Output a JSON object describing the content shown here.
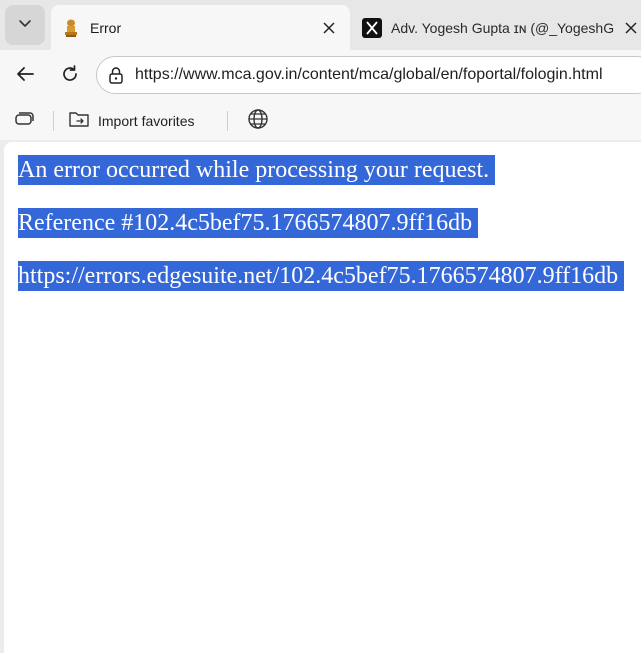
{
  "tabs": [
    {
      "title": "Error",
      "favicon": "emblem-icon",
      "active": true
    },
    {
      "title": "Adv. Yogesh Gupta ɪɴ (@_YogeshG",
      "favicon": "x-logo-icon",
      "active": false
    }
  ],
  "address_bar": {
    "url": "https://www.mca.gov.in/content/mca/global/en/foportal/fologin.html"
  },
  "favorites_bar": {
    "import_label": "Import favorites"
  },
  "page": {
    "lines": [
      "An error occurred while processing your request.",
      "Reference #102.4c5bef75.1766574807.9ff16db",
      "https://errors.edgesuite.net/102.4c5bef75.1766574807.9ff16db"
    ],
    "selection_color": "#3468d8"
  }
}
